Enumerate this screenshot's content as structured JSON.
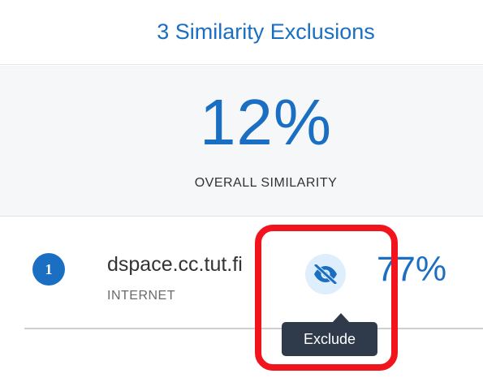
{
  "header": {
    "exclusions_label": "3 Similarity Exclusions"
  },
  "summary": {
    "overall_percent": "12%",
    "overall_label": "OVERALL SIMILARITY"
  },
  "sources": [
    {
      "rank": "1",
      "name": "dspace.cc.tut.fi",
      "type": "INTERNET",
      "percent": "77%"
    }
  ],
  "tooltip": {
    "text": "Exclude"
  },
  "icons": {
    "exclude_button": "eye-off-icon"
  },
  "colors": {
    "accent": "#1a6fc2",
    "highlight": "#f2141d",
    "tooltip_bg": "#2f3b4a",
    "icon_bg": "#dfeefd"
  }
}
